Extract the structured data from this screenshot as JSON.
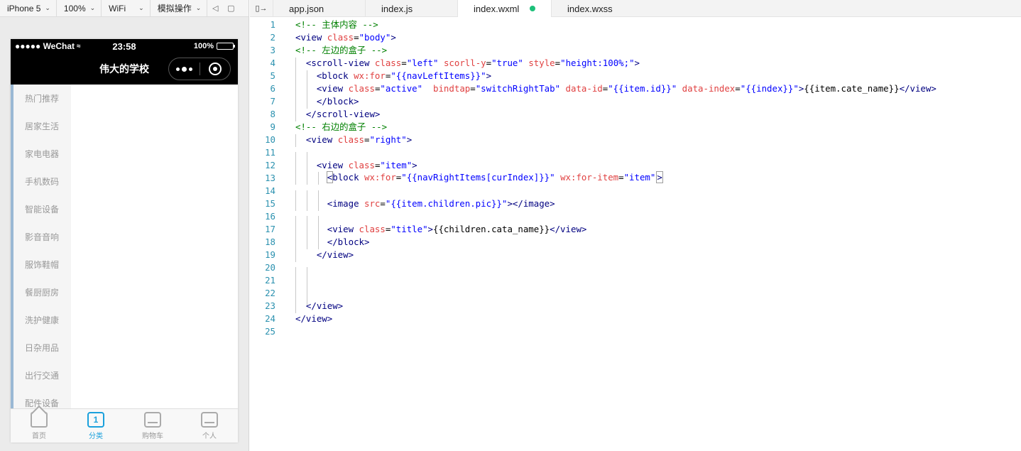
{
  "simulator": {
    "toolbar": {
      "device": "iPhone 5",
      "zoom": "100%",
      "network": "WiFi",
      "simulate_op": "模拟操作"
    },
    "status_bar": {
      "carrier": "●●●●● WeChat",
      "time": "23:58",
      "battery": "100%"
    },
    "nav_title": "伟大的学校",
    "menu_items": [
      "热门推荐",
      "居家生活",
      "家电电器",
      "手机数码",
      "智能设备",
      "影音音响",
      "服饰鞋帽",
      "餐厨厨房",
      "洗护健康",
      "日杂用品",
      "出行交通",
      "配件设备"
    ],
    "tabbar": [
      {
        "label": "首页",
        "icon": "home-icon"
      },
      {
        "label": "分类",
        "icon": "category-icon",
        "active": true
      },
      {
        "label": "购物车",
        "icon": "cart-icon"
      },
      {
        "label": "个人",
        "icon": "profile-icon"
      }
    ],
    "colors": {
      "active_tab": "#1aa0dc",
      "menu_accent": "#9ab8d4"
    }
  },
  "editor": {
    "files": [
      {
        "name": "app.json"
      },
      {
        "name": "index.js"
      },
      {
        "name": "index.wxml",
        "active": true,
        "modified": true
      },
      {
        "name": "index.wxss"
      }
    ],
    "line_numbers": [
      "1",
      "2",
      "3",
      "4",
      "5",
      "6",
      "7",
      "8",
      "9",
      "10",
      "11",
      "12",
      "13",
      "14",
      "15",
      "16",
      "17",
      "18",
      "19",
      "20",
      "21",
      "22",
      "23",
      "24",
      "25"
    ],
    "colors": {
      "tag": "#000080",
      "attr": "#e04040",
      "string": "#0000ff",
      "comment": "#008000",
      "line_number": "#2b91af"
    }
  }
}
